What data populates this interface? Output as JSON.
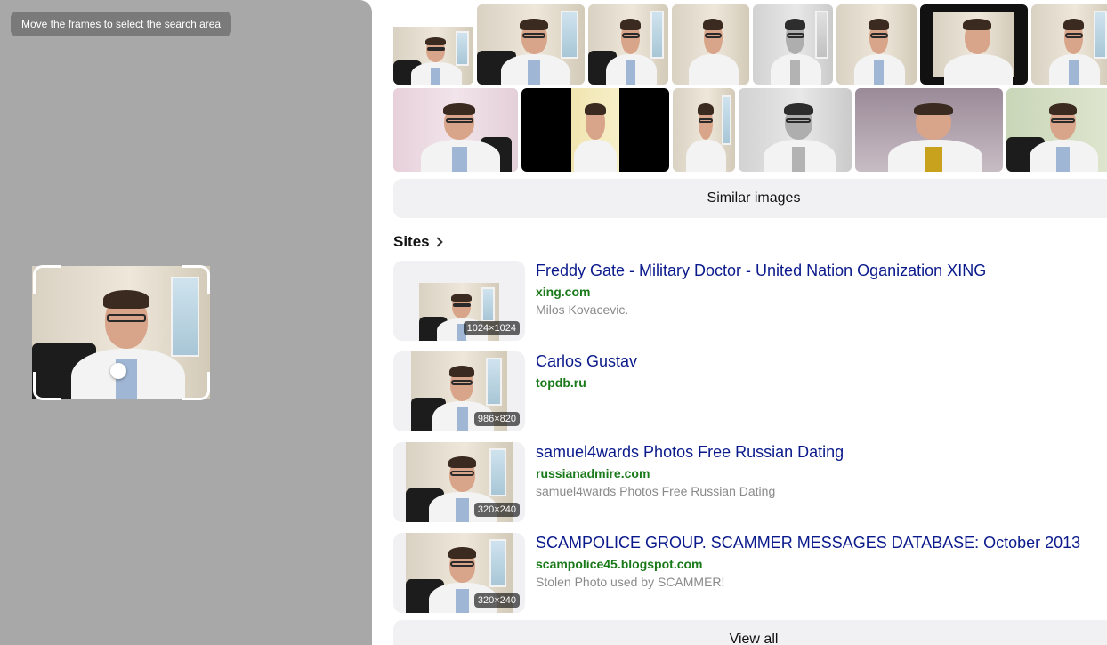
{
  "crop_panel": {
    "hint": "Move the frames to select the search area"
  },
  "similar": {
    "button_label": "Similar images",
    "row1": [
      "doctor-photo",
      "doctor-photo",
      "doctor-photo",
      "doctor-photo",
      "doctor-photo-grayscale",
      "doctor-photo",
      "doctor-photo-framed",
      "doctor-photo"
    ],
    "row2": [
      "doctor-photo-pink-wall",
      "doctor-photo-letterbox",
      "doctor-photo",
      "doctor-photo",
      "doctor-photo-purple-wall",
      "doctor-photo"
    ]
  },
  "sites": {
    "title": "Sites",
    "items": [
      {
        "title": "Freddy Gate - Military Doctor - United Nation Oganization XING",
        "domain": "xing.com",
        "description": "Milos Kovacevic.",
        "dimensions": "1024×1024"
      },
      {
        "title": "Carlos Gustav",
        "domain": "topdb.ru",
        "description": "",
        "dimensions": "986×820"
      },
      {
        "title": "samuel4wards Photos Free Russian Dating",
        "domain": "russianadmire.com",
        "description": "samuel4wards Photos Free Russian Dating",
        "dimensions": "320×240"
      },
      {
        "title": "SCAMPOLICE GROUP. SCAMMER MESSAGES DATABASE: October 2013",
        "domain": "scampolice45.blogspot.com",
        "description": "Stolen Photo used by SCAMMER!",
        "dimensions": "320×240"
      }
    ],
    "view_all_label": "View all"
  }
}
